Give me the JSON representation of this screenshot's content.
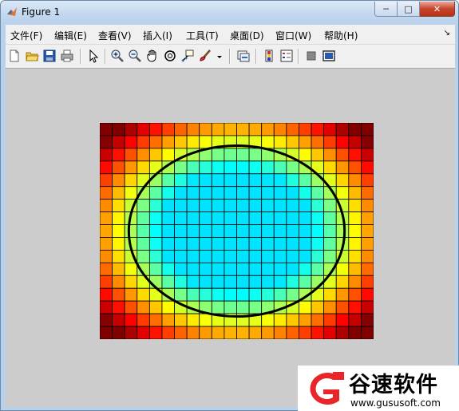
{
  "window": {
    "title": "Figure 1",
    "controls": {
      "minimize": "─",
      "maximize": "□",
      "close": "✕"
    }
  },
  "menu": {
    "items": [
      {
        "label": "文件(F)"
      },
      {
        "label": "编辑(E)"
      },
      {
        "label": "查看(V)"
      },
      {
        "label": "插入(I)"
      },
      {
        "label": "工具(T)"
      },
      {
        "label": "桌面(D)"
      },
      {
        "label": "窗口(W)"
      },
      {
        "label": "帮助(H)"
      }
    ],
    "overflow": "↘"
  },
  "toolbar": {
    "icons": [
      "new-figure-icon",
      "open-file-icon",
      "save-icon",
      "print-icon",
      "edit-plot-arrow-icon",
      "zoom-in-icon",
      "zoom-out-icon",
      "pan-hand-icon",
      "rotate-3d-icon",
      "data-cursor-icon",
      "brush-icon",
      "brush-dropdown-icon",
      "link-plot-icon",
      "insert-colorbar-icon",
      "insert-legend-icon",
      "hide-plot-tools-icon",
      "show-plot-tools-icon"
    ]
  },
  "plot": {
    "type": "pcolor-mesh-with-ellipse",
    "grid_cols": 22,
    "grid_rows": 17,
    "colormap": "jet",
    "fill_level_center": 0.35,
    "ellipse_color": "#000000",
    "edge_color": "#000000"
  },
  "watermark": {
    "name": "谷速软件",
    "url": "www.gususoft.com",
    "accent": "#e8262a"
  }
}
